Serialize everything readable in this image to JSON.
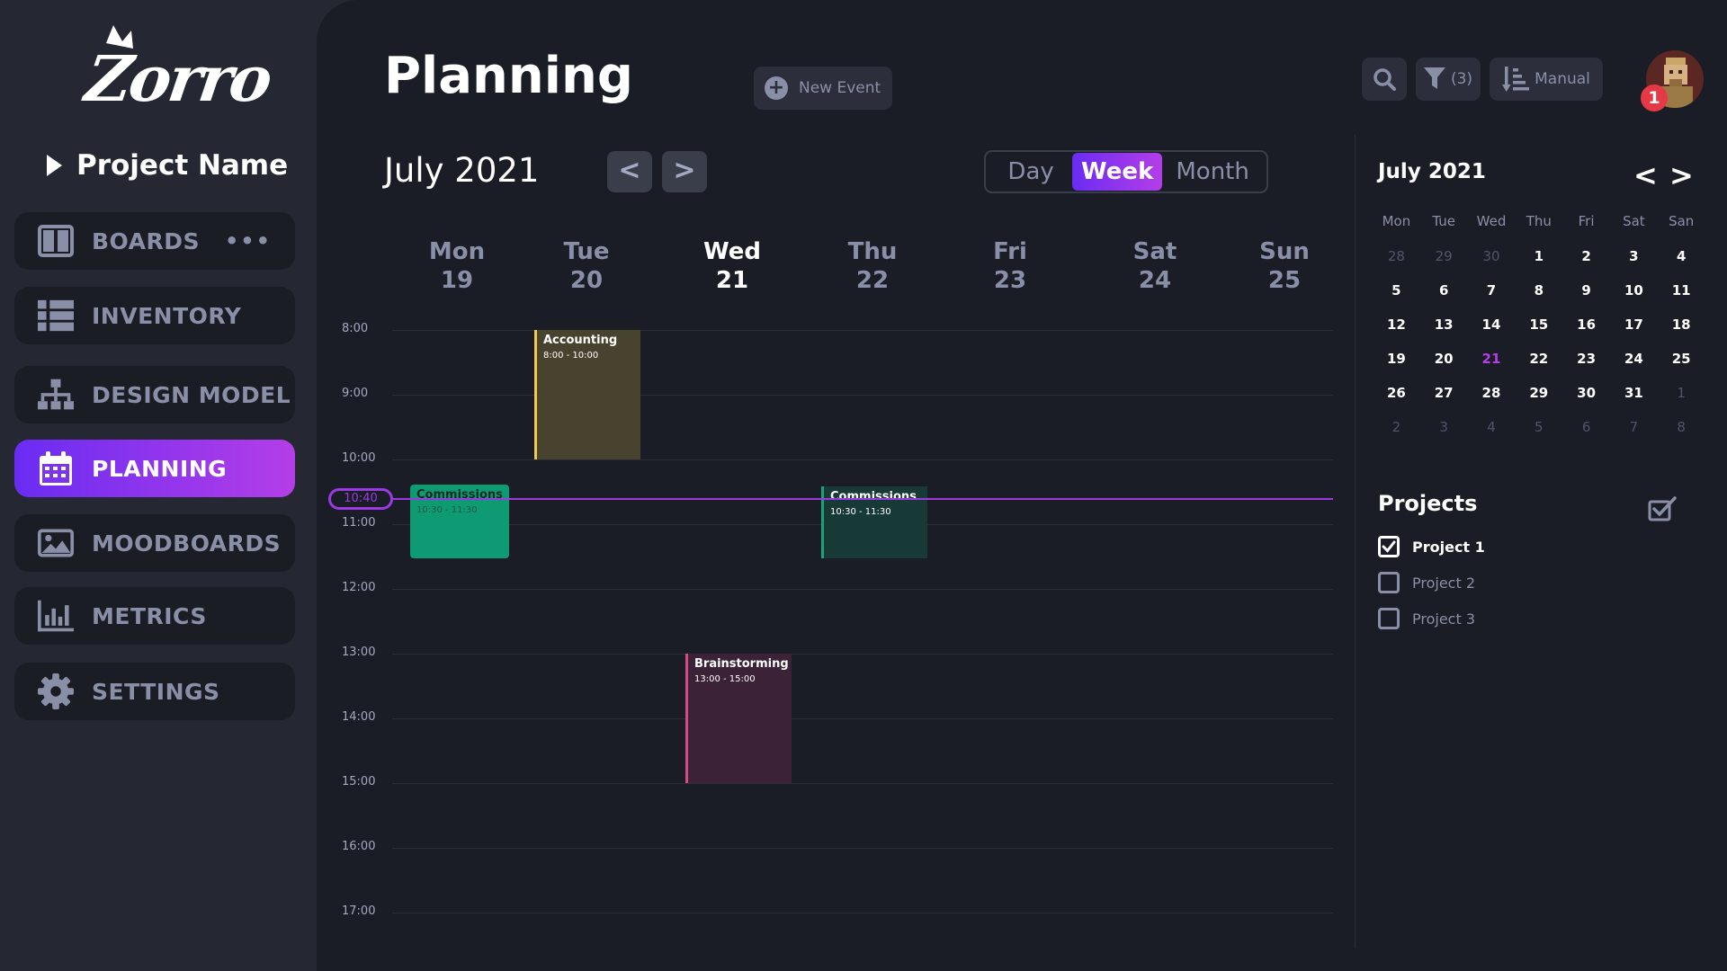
{
  "app": {
    "logo_text": "Zorro",
    "project_name": "Project Name"
  },
  "sidebar": {
    "items": [
      {
        "label": "BOARDS",
        "icon": "board-icon",
        "more": "•••"
      },
      {
        "label": "INVENTORY",
        "icon": "list-icon"
      },
      {
        "label": "DESIGN MODEL",
        "icon": "hierarchy-icon"
      },
      {
        "label": "PLANNING",
        "icon": "calendar-icon",
        "active": true
      },
      {
        "label": "MOODBOARDS",
        "icon": "image-icon"
      },
      {
        "label": "METRICS",
        "icon": "bar-chart-icon"
      },
      {
        "label": "SETTINGS",
        "icon": "gear-icon"
      }
    ]
  },
  "header": {
    "title": "Planning",
    "new_event_label": "New Event",
    "filter_count": "(3)",
    "sort_label": "Manual",
    "notification_count": "1"
  },
  "calendar": {
    "month_label": "July 2021",
    "prev": "<",
    "next": ">",
    "views": [
      "Day",
      "Week",
      "Month"
    ],
    "active_view": "Week",
    "days": [
      {
        "name": "Mon",
        "num": "19"
      },
      {
        "name": "Tue",
        "num": "20"
      },
      {
        "name": "Wed",
        "num": "21",
        "today": true
      },
      {
        "name": "Thu",
        "num": "22"
      },
      {
        "name": "Fri",
        "num": "23"
      },
      {
        "name": "Sat",
        "num": "24"
      },
      {
        "name": "Sun",
        "num": "25"
      }
    ],
    "hours": [
      "8:00",
      "9:00",
      "10:00",
      "11:00",
      "12:00",
      "13:00",
      "14:00",
      "15:00",
      "16:00",
      "17:00"
    ],
    "now": "10:40",
    "events": [
      {
        "title": "Accounting",
        "time": "8:00 - 10:00",
        "day": 1,
        "start": 8.0,
        "end": 10.0,
        "color": "#f2c94c",
        "bg": "#47432f"
      },
      {
        "title": "Commissions",
        "time": "10:30 - 11:30",
        "day": 0,
        "start": 10.4,
        "end": 11.55,
        "color": "#0e9b73",
        "bg": "#0e9b73",
        "dark_text": true
      },
      {
        "title": "Commissions",
        "time": "10:30 - 11:30",
        "day": 3,
        "start": 10.42,
        "end": 11.55,
        "color": "#1aa37a",
        "bg": "#173a36"
      },
      {
        "title": "Brainstorming",
        "time": "13:00 - 15:00",
        "day": 2,
        "start": 13.0,
        "end": 15.0,
        "color": "#d44a86",
        "bg": "#3c2236"
      }
    ]
  },
  "mini_calendar": {
    "title": "July 2021",
    "prev": "<",
    "next": ">",
    "weekdays": [
      "Mon",
      "Tue",
      "Wed",
      "Thu",
      "Fri",
      "Sat",
      "San"
    ],
    "weeks": [
      [
        "28",
        "29",
        "30",
        "1",
        "2",
        "3",
        "4"
      ],
      [
        "5",
        "6",
        "7",
        "8",
        "9",
        "10",
        "11"
      ],
      [
        "12",
        "13",
        "14",
        "15",
        "16",
        "17",
        "18"
      ],
      [
        "19",
        "20",
        "21",
        "22",
        "23",
        "24",
        "25"
      ],
      [
        "26",
        "27",
        "28",
        "29",
        "30",
        "31",
        "1"
      ],
      [
        "2",
        "3",
        "4",
        "5",
        "6",
        "7",
        "8"
      ]
    ],
    "today": "21"
  },
  "projects": {
    "title": "Projects",
    "items": [
      {
        "label": "Project 1",
        "checked": true
      },
      {
        "label": "Project 2",
        "checked": false
      },
      {
        "label": "Project 3",
        "checked": false
      }
    ]
  },
  "colors": {
    "accent": "#9b39e3",
    "accent_gradient_start": "#6a2cf2",
    "accent_gradient_end": "#b43ee8"
  }
}
